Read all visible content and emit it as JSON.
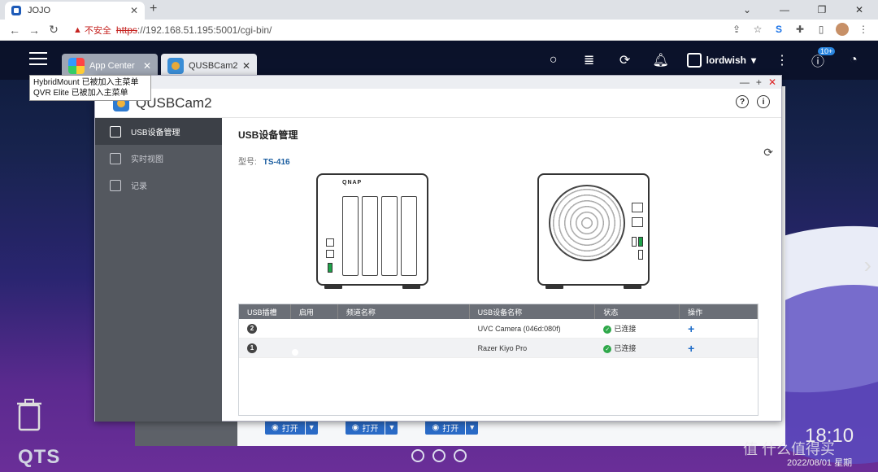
{
  "browser": {
    "tab_title": "JOJO",
    "insecure_label": "不安全",
    "url_scheme": "https",
    "url_rest": "://192.168.51.195:5001/cgi-bin/"
  },
  "qts": {
    "tabs": [
      {
        "label": "App Center"
      },
      {
        "label": "QUSBCam2"
      }
    ],
    "username": "lordwish",
    "notification_badge": "10+",
    "tooltip_lines": [
      "HybridMount 已被加入主菜单",
      "QVR Elite 已被加入主菜单"
    ],
    "brand": "QTS",
    "clock": "18:10",
    "date": "2022/08/01 星期",
    "watermark": "值 什么值得买"
  },
  "app": {
    "title": "QUSBCam2",
    "sidebar": [
      {
        "label": "USB设备管理",
        "icon": "usb-manage-icon",
        "active": true
      },
      {
        "label": "实时视图",
        "icon": "live-view-icon",
        "active": false
      },
      {
        "label": "记录",
        "icon": "record-icon",
        "active": false
      }
    ],
    "page_title": "USB设备管理",
    "model_label": "型号:",
    "model_value": "TS-416",
    "nas_brand": "QNAP",
    "table": {
      "headers": [
        "USB插槽",
        "启用",
        "频道名称",
        "USB设备名称",
        "状态",
        "操作"
      ],
      "rows": [
        {
          "slot": "2",
          "enabled": true,
          "channel": "",
          "device": "UVC Camera (046d:080f)",
          "status": "已连接",
          "action": "+"
        },
        {
          "slot": "1",
          "enabled": true,
          "channel": "",
          "device": "Razer Kiyo Pro",
          "status": "已连接",
          "action": "+"
        }
      ]
    }
  },
  "background_buttons": [
    {
      "label": "打开"
    },
    {
      "label": "打开"
    },
    {
      "label": "打开"
    }
  ]
}
